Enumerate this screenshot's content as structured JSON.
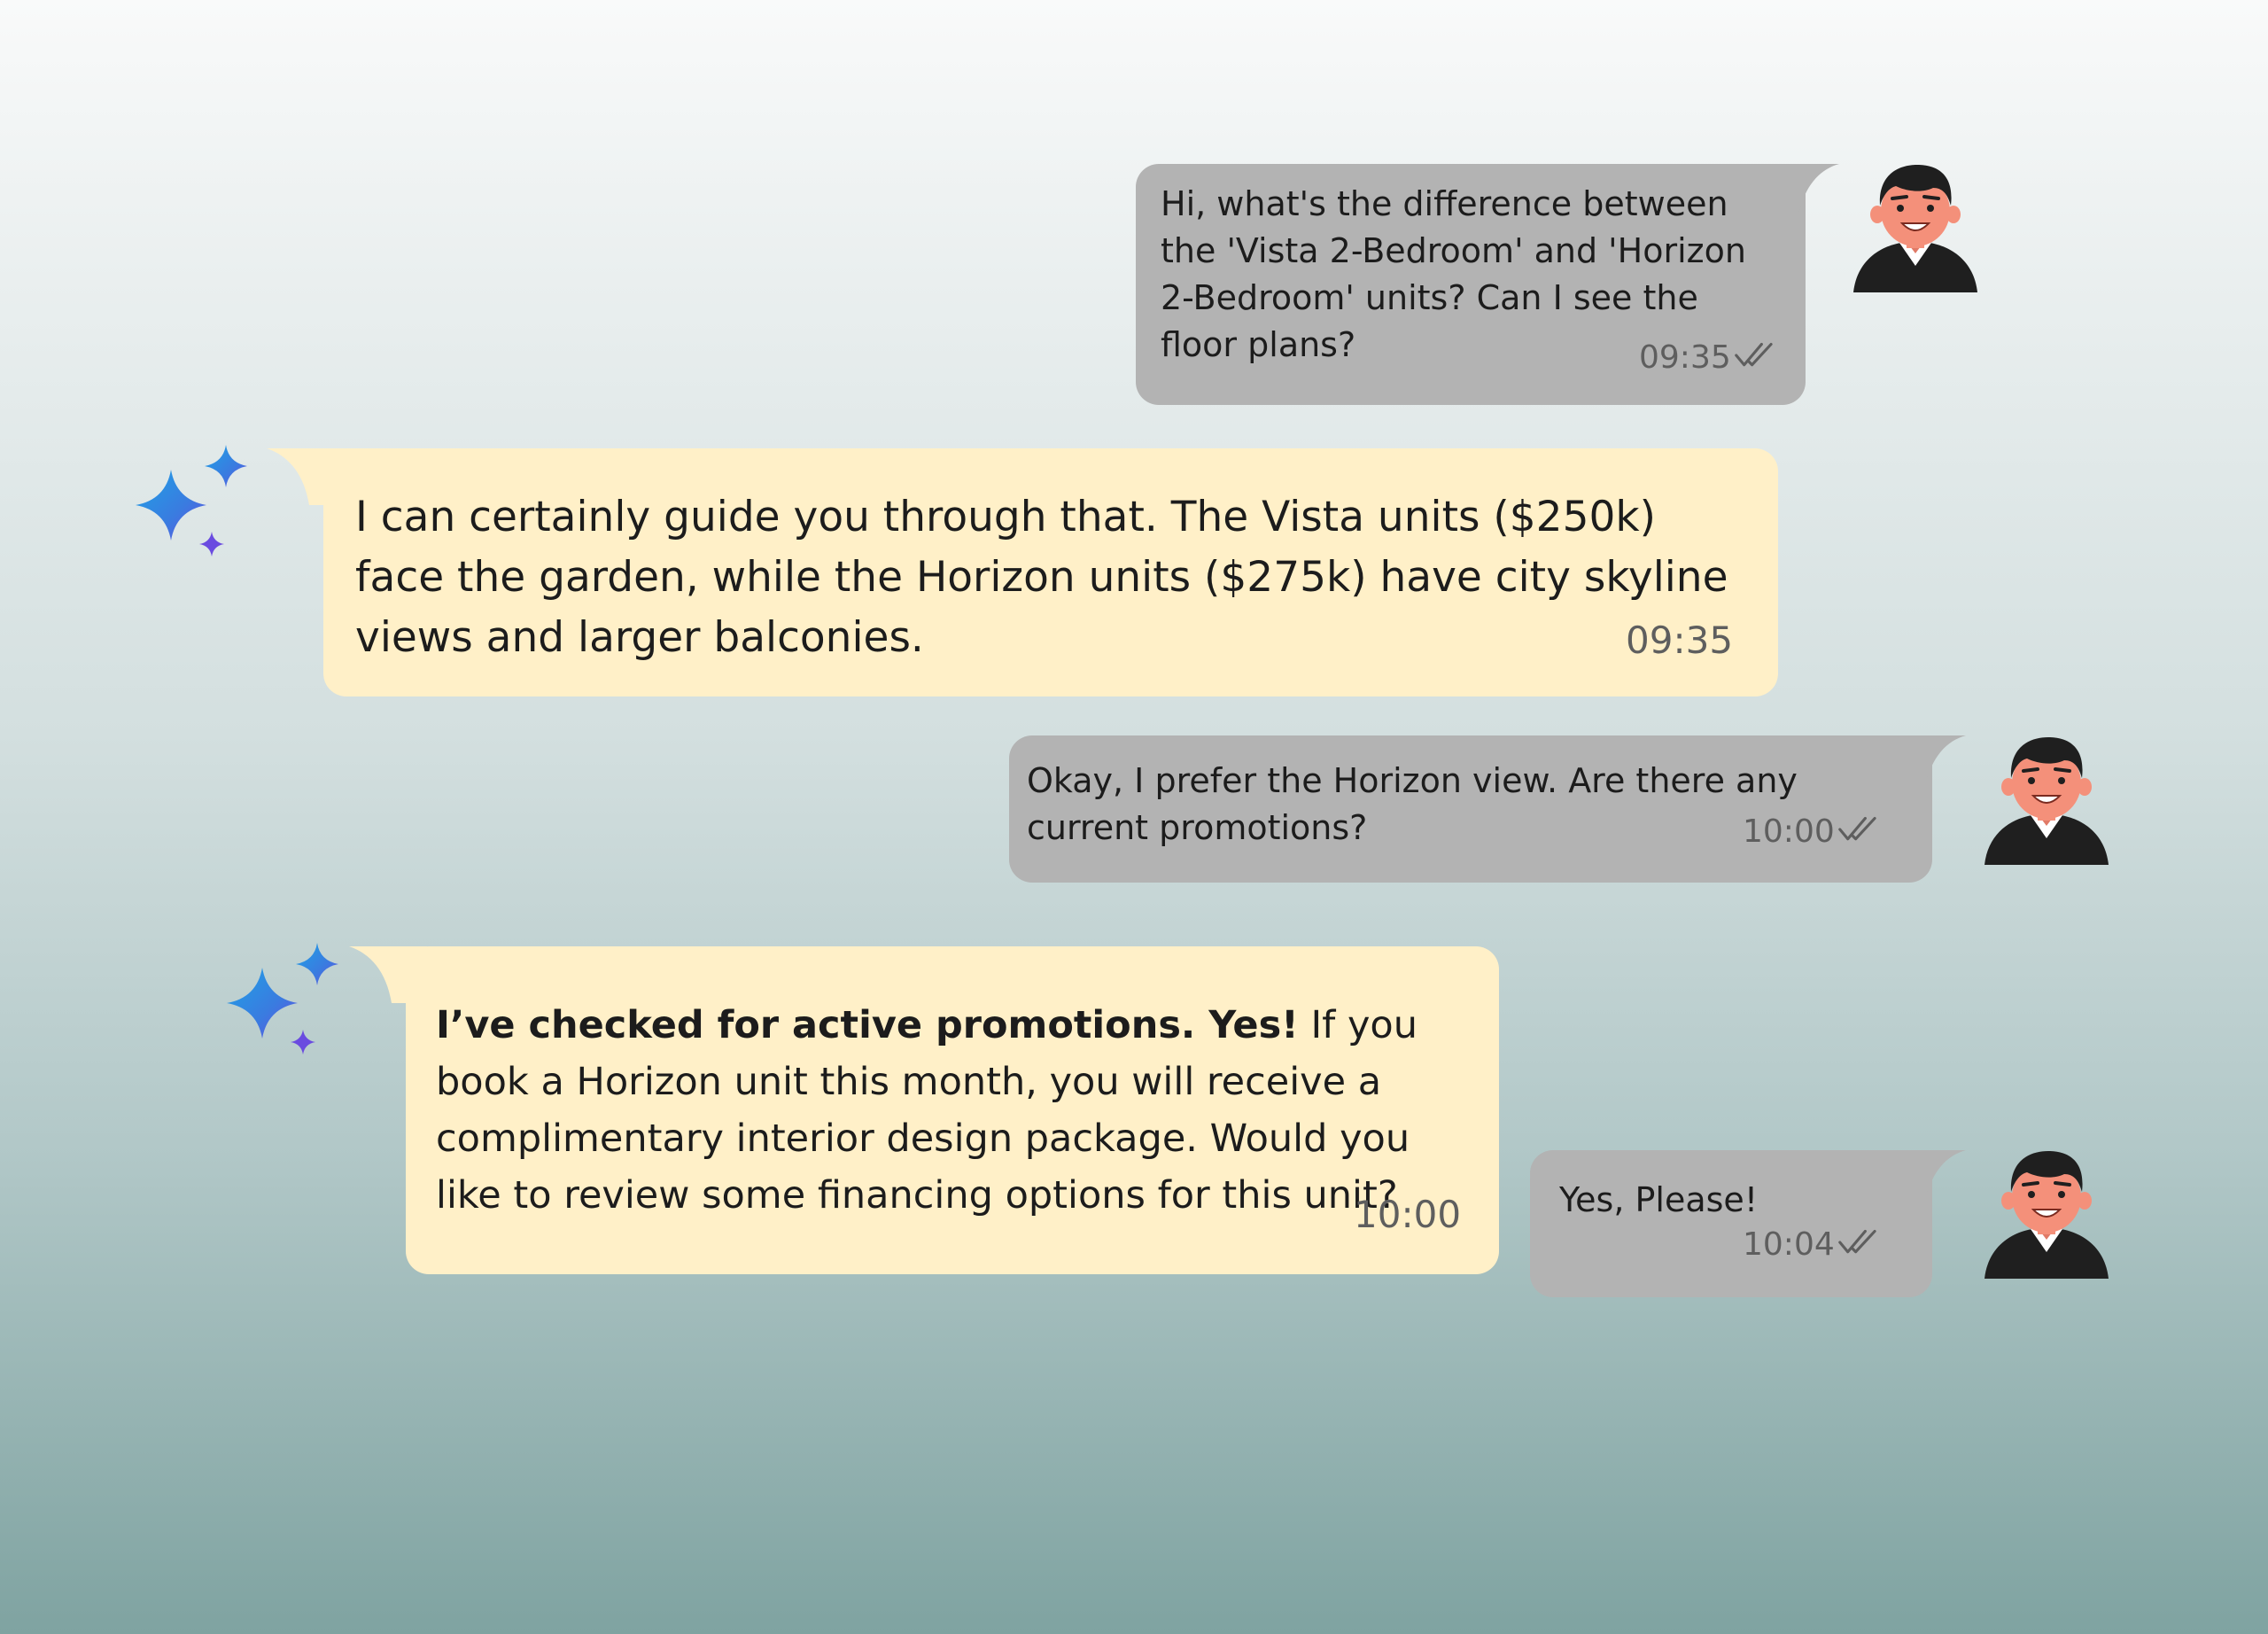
{
  "messages": [
    {
      "sender": "user",
      "text": "Hi, what's the difference between the 'Vista 2-Bedroom' and 'Horizon 2-Bedroom' units? Can I see the floor plans?",
      "time": "09:35",
      "read_receipt": "double-check-icon"
    },
    {
      "sender": "assistant",
      "text": "I can certainly guide you through that. The Vista units ($250k) face the garden, while the Horizon units ($275k) have city skyline views and larger balconies.",
      "time": "09:35"
    },
    {
      "sender": "user",
      "text": "Okay, I prefer the Horizon view. Are there any current promotions?",
      "time": "10:00",
      "read_receipt": "double-check-icon"
    },
    {
      "sender": "assistant",
      "bold_text": "I’ve checked for active promotions. Yes!",
      "text": " If you book a Horizon unit this month, you will receive a complimentary interior design package. Would you like to review some financing options for this unit?",
      "time": "10:00"
    },
    {
      "sender": "user",
      "text": "Yes, Please!",
      "time": "10:04",
      "read_receipt": "double-check-icon"
    }
  ],
  "colors": {
    "user_bubble": "#b3b3b3",
    "assistant_bubble": "#fff0c8",
    "timestamp": "#5e5e5e",
    "sparkle_blue": "#2f8fe0",
    "sparkle_purple": "#6a4be0",
    "avatar_skin": "#f4907a",
    "avatar_hair": "#1f1f1f"
  },
  "icons": {
    "user_avatar": "user-avatar-icon",
    "assistant_avatar": "sparkle-icon",
    "read_receipt": "double-check-icon"
  }
}
